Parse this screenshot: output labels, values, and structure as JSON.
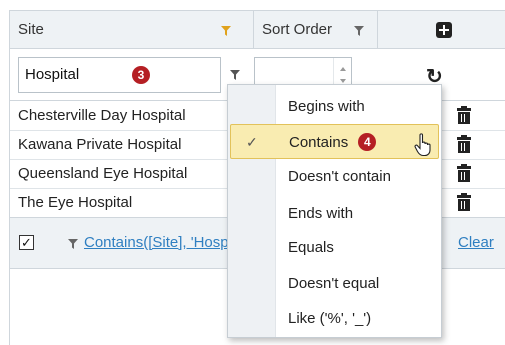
{
  "header": {
    "site_label": "Site",
    "sort_label": "Sort Order"
  },
  "filter": {
    "site_value": "Hospital",
    "site_badge": "3",
    "sort_value": ""
  },
  "rows": [
    {
      "site": "Chesterville Day Hospital"
    },
    {
      "site": "Kawana Private Hospital"
    },
    {
      "site": "Queensland Eye Hospital"
    },
    {
      "site": "The Eye Hospital"
    }
  ],
  "footer": {
    "checkbox_mark": "✓",
    "filter_expression": "Contains([Site], 'Hospital')",
    "clear_label": "Clear"
  },
  "menu": {
    "items": [
      {
        "label": "Begins with"
      },
      {
        "label": "Contains",
        "selected": true,
        "badge": "4"
      },
      {
        "label": "Doesn't contain"
      },
      {
        "label": "Ends with"
      },
      {
        "label": "Equals"
      },
      {
        "label": "Doesn't equal"
      },
      {
        "label": "Like ('%', '_')"
      }
    ],
    "check_mark": "✓"
  },
  "colors": {
    "header_bg": "#eef2f5",
    "badge_red": "#b51f24",
    "link_blue": "#2f7fc1",
    "highlight": "#f9ecb1",
    "gold_funnel": "#e0a21c"
  },
  "icons": [
    "filter-funnel-icon",
    "add-icon",
    "refresh-icon",
    "trash-icon",
    "checkmark-icon",
    "hand-cursor-icon"
  ]
}
